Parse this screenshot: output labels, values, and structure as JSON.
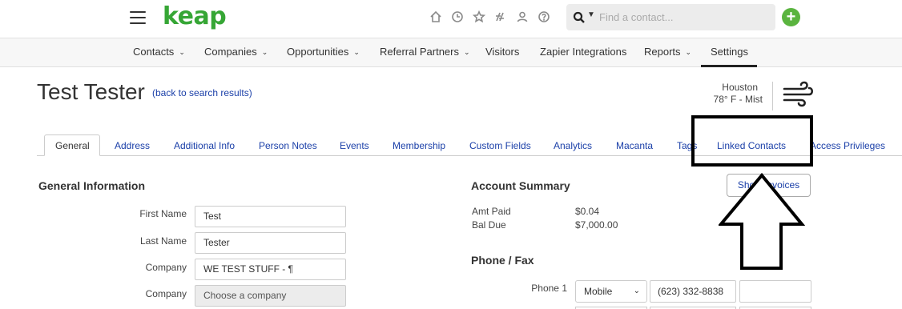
{
  "header": {
    "logo": "keap",
    "search_placeholder": "Find a contact...",
    "search_caret": "▼",
    "add_label": "+"
  },
  "nav": {
    "items": [
      {
        "label": "Contacts",
        "dropdown": true
      },
      {
        "label": "Companies",
        "dropdown": true
      },
      {
        "label": "Opportunities",
        "dropdown": true
      },
      {
        "label": "Referral Partners",
        "dropdown": true
      },
      {
        "label": "Visitors",
        "dropdown": false
      },
      {
        "label": "Zapier Integrations",
        "dropdown": false
      },
      {
        "label": "Reports",
        "dropdown": true
      },
      {
        "label": "Settings",
        "dropdown": false,
        "active": true
      }
    ],
    "caret": "⌄"
  },
  "title": {
    "name": "Test Tester",
    "back_link": "(back to search results)"
  },
  "weather": {
    "city": "Houston",
    "conditions": "78° F - Mist",
    "icon": "wind-icon"
  },
  "tabs": [
    {
      "label": "General",
      "active": true
    },
    {
      "label": "Address"
    },
    {
      "label": "Additional Info"
    },
    {
      "label": "Person Notes"
    },
    {
      "label": "Events"
    },
    {
      "label": "Membership"
    },
    {
      "label": "Custom Fields"
    },
    {
      "label": "Analytics"
    },
    {
      "label": "Macanta"
    },
    {
      "label": "Tags"
    },
    {
      "label": "Linked Contacts"
    },
    {
      "label": "Access Privileges"
    }
  ],
  "general_info": {
    "heading": "General Information",
    "fields": [
      {
        "label": "First Name",
        "value": "Test"
      },
      {
        "label": "Last Name",
        "value": "Tester"
      },
      {
        "label": "Company",
        "value": "WE TEST STUFF - ¶"
      },
      {
        "label": "Company",
        "value": "Choose a company"
      }
    ]
  },
  "account_summary": {
    "heading": "Account Summary",
    "show_invoices": "Show Invoices",
    "rows": [
      {
        "label": "Amt Paid",
        "value": "$0.04"
      },
      {
        "label": "Bal Due",
        "value": "$7,000.00"
      }
    ]
  },
  "phone_fax": {
    "heading": "Phone / Fax",
    "phone1_label": "Phone 1",
    "phone1_type": "Mobile",
    "phone1_number": "(623) 332-8838",
    "type_caret": "⌄"
  },
  "colors": {
    "brand_green": "#36a635",
    "link_blue": "#1a3fa8"
  }
}
